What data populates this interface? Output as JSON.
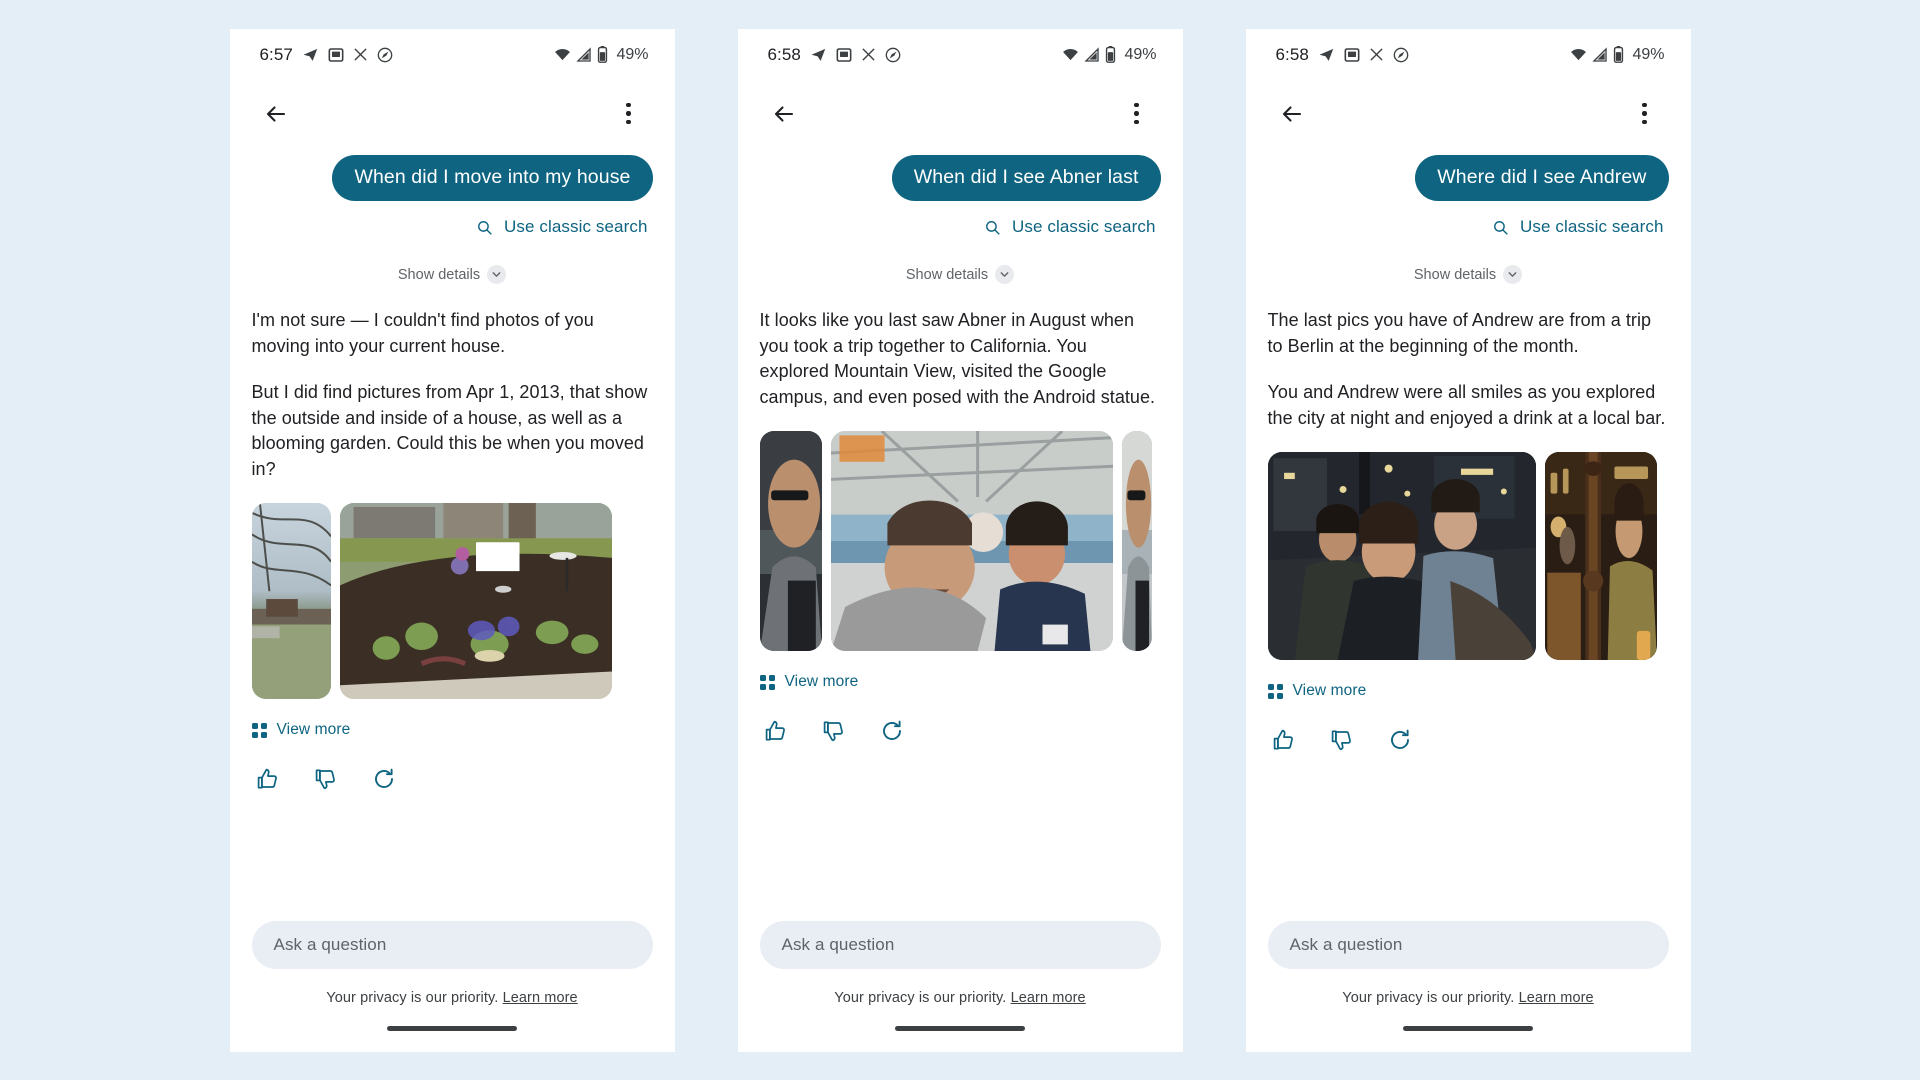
{
  "app": {
    "accent_color": "#0e6481",
    "background_color": "#e3eef7",
    "phone_bg": "#ffffff",
    "text_color": "#202124",
    "muted_text_color": "#5f6368"
  },
  "panels": [
    {
      "status_bar": {
        "time": "6:57",
        "battery_percent": "49%",
        "left_icons": [
          "telegram-icon",
          "message-icon",
          "x-icon",
          "compass-icon"
        ],
        "right_icons": [
          "wifi-icon",
          "signal-icon",
          "battery-icon"
        ]
      },
      "app_bar": {
        "back_label": "Back",
        "overflow_label": "More options"
      },
      "query": "When did I move into my house",
      "classic_search_label": "Use classic search",
      "show_details_label": "Show details",
      "answer_paragraphs": [
        "I'm not sure — I couldn't find photos of you moving into your current house.",
        "But I did find pictures from Apr 1, 2013, that show the outside and inside of a house, as well as a blooming garden. Could this be when you moved in?"
      ],
      "photos": [
        {
          "alt": "backyard-lawn-with-bare-tree-branches",
          "scene": "yard"
        },
        {
          "alt": "blooming-garden-bed-with-white-picket-fence",
          "scene": "garden"
        }
      ],
      "view_more_label": "View more",
      "feedback": [
        "thumb-up-icon",
        "thumb-down-icon",
        "regenerate-icon"
      ],
      "composer_placeholder": "Ask a question",
      "privacy_text": "Your privacy is our priority.",
      "privacy_link": "Learn more"
    },
    {
      "status_bar": {
        "time": "6:58",
        "battery_percent": "49%",
        "left_icons": [
          "telegram-icon",
          "message-icon",
          "x-icon",
          "compass-icon"
        ],
        "right_icons": [
          "wifi-icon",
          "signal-icon",
          "battery-icon"
        ]
      },
      "app_bar": {
        "back_label": "Back",
        "overflow_label": "More options"
      },
      "query": "When did I see Abner last",
      "classic_search_label": "Use classic search",
      "show_details_label": "Show details",
      "answer_paragraphs": [
        "It looks like you last saw Abner in August when you took a trip together to California. You explored Mountain View, visited the Google campus, and even posed with the Android statue."
      ],
      "photos": [
        {
          "alt": "man-in-sunglasses-with-backpack",
          "scene": "sunglasses"
        },
        {
          "alt": "selfie-of-two-men-under-a-pavilion-roof",
          "scene": "pavilion"
        },
        {
          "alt": "partial-photo-cut-off-at-edge",
          "scene": "pavilion-edge"
        }
      ],
      "view_more_label": "View more",
      "feedback": [
        "thumb-up-icon",
        "thumb-down-icon",
        "regenerate-icon"
      ],
      "composer_placeholder": "Ask a question",
      "privacy_text": "Your privacy is our priority.",
      "privacy_link": "Learn more"
    },
    {
      "status_bar": {
        "time": "6:58",
        "battery_percent": "49%",
        "left_icons": [
          "telegram-icon",
          "message-icon",
          "x-icon",
          "compass-icon"
        ],
        "right_icons": [
          "wifi-icon",
          "signal-icon",
          "battery-icon"
        ]
      },
      "app_bar": {
        "back_label": "Back",
        "overflow_label": "More options"
      },
      "query": "Where did I see Andrew",
      "classic_search_label": "Use classic search",
      "show_details_label": "Show details",
      "answer_paragraphs": [
        "The last pics you have of Andrew are from a trip to Berlin at the beginning of the month.",
        "You and Andrew were all smiles as you explored the city at night and enjoyed a drink at a local bar."
      ],
      "photos": [
        {
          "alt": "night-street-selfie-with-three-men",
          "scene": "night-street"
        },
        {
          "alt": "bar-interior-with-man-smiling",
          "scene": "bar"
        }
      ],
      "view_more_label": "View more",
      "feedback": [
        "thumb-up-icon",
        "thumb-down-icon",
        "regenerate-icon"
      ],
      "composer_placeholder": "Ask a question",
      "privacy_text": "Your privacy is our priority.",
      "privacy_link": "Learn more"
    }
  ]
}
